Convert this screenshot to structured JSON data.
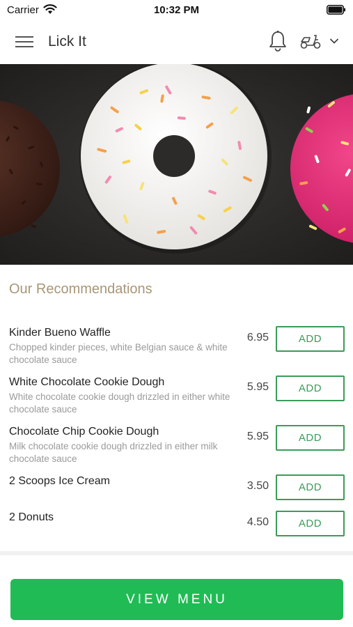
{
  "status_bar": {
    "carrier": "Carrier",
    "time": "10:32 PM"
  },
  "nav": {
    "title": "Lick It",
    "icons": [
      "menu-icon",
      "bell-icon",
      "scooter-icon",
      "chevron-down-icon"
    ]
  },
  "hero": {
    "icon": "donut-banner-image"
  },
  "recommendations": {
    "title": "Our Recommendations",
    "items": [
      {
        "name": "Kinder Bueno Waffle",
        "description": "Chopped kinder pieces, white Belgian sauce & white chocolate sauce",
        "price": "6.95",
        "add_label": "ADD"
      },
      {
        "name": "White Chocolate Cookie Dough",
        "description": "White chocolate cookie dough drizzled in either white chocolate sauce",
        "price": "5.95",
        "add_label": "ADD"
      },
      {
        "name": "Chocolate Chip Cookie Dough",
        "description": "Milk chocolate cookie dough drizzled in either milk chocolate sauce",
        "price": "5.95",
        "add_label": "ADD"
      },
      {
        "name": "2 Scoops Ice Cream",
        "description": "",
        "price": "3.50",
        "add_label": "ADD"
      },
      {
        "name": "2 Donuts",
        "description": "",
        "price": "4.50",
        "add_label": "ADD"
      }
    ]
  },
  "footer": {
    "view_menu_label": "VIEW MENU"
  },
  "colors": {
    "accent_green": "#20bb55",
    "add_outline": "#3a9c58",
    "section_title": "#a89676"
  }
}
